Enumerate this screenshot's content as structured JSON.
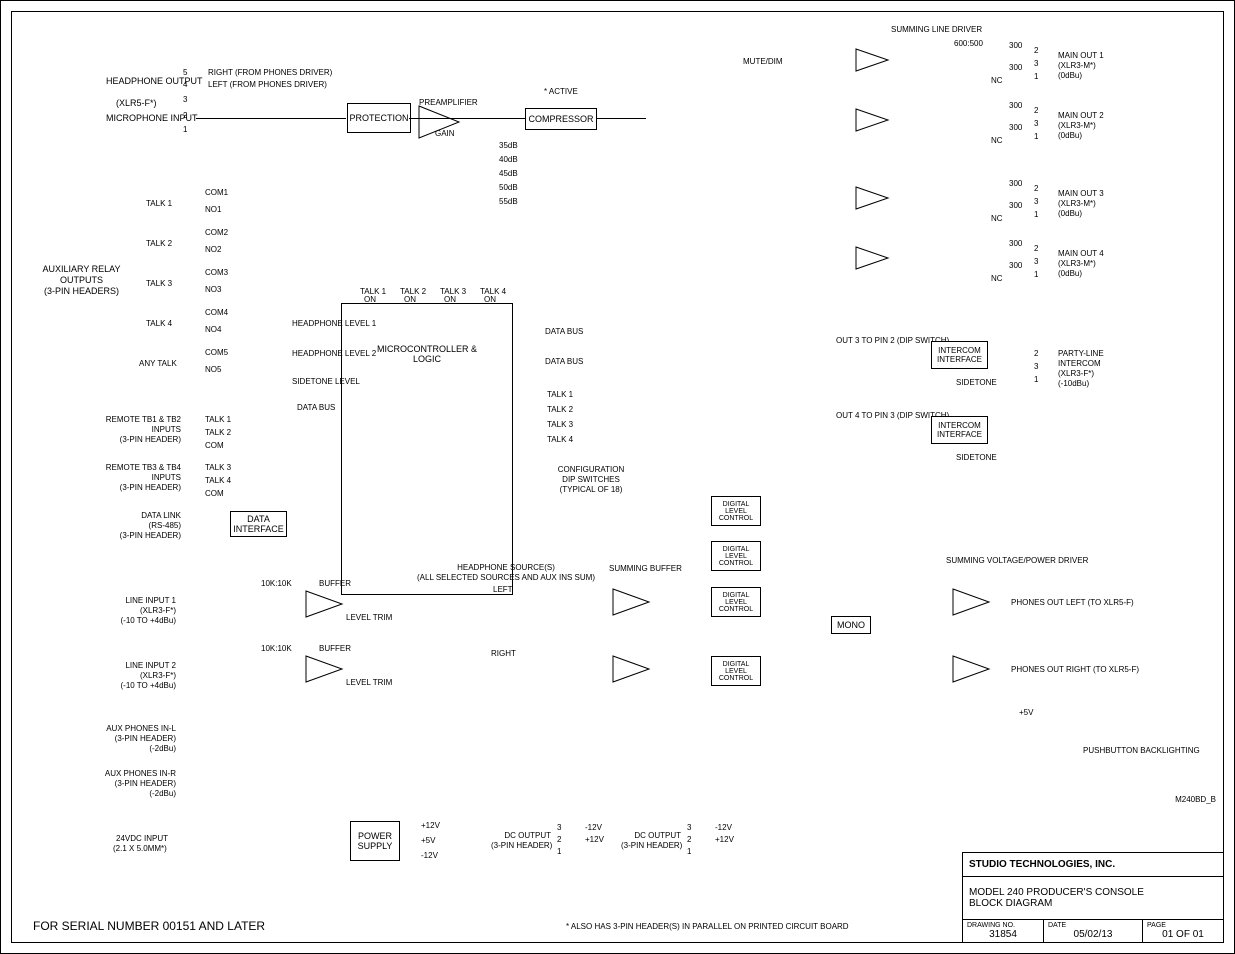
{
  "titleblock": {
    "company": "STUDIO TECHNOLOGIES, INC.",
    "title_l1": "MODEL 240 PRODUCER'S CONSOLE",
    "title_l2": "BLOCK DIAGRAM",
    "drawing_no_k": "DRAWING NO.",
    "drawing_no_v": "31854",
    "date_k": "DATE",
    "date_v": "05/02/13",
    "page_k": "PAGE",
    "page_v": "01  OF  01"
  },
  "footer": {
    "serial": "FOR SERIAL NUMBER 00151 AND LATER",
    "note": "* ALSO HAS 3-PIN HEADER(S) IN PARALLEL ON PRINTED CIRCUIT BOARD",
    "code": "M240BD_B"
  },
  "left": {
    "hp_out": "HEADPHONE OUTPUT",
    "hp_conn": "(XLR5-F*)",
    "mic_in": "MICROPHONE INPUT",
    "pin5": "5",
    "pin4": "4",
    "pin3": "3",
    "pin2": "2",
    "pin1": "1",
    "pin5_lbl": "RIGHT (FROM PHONES DRIVER)",
    "pin4_lbl": "LEFT (FROM PHONES DRIVER)",
    "aux_relay_t": "AUXILIARY RELAY",
    "aux_relay_b1": "OUTPUTS",
    "aux_relay_b2": "(3-PIN HEADERS)",
    "talk1": "TALK 1",
    "talk2": "TALK 2",
    "talk3": "TALK 3",
    "talk4": "TALK 4",
    "anytalk": "ANY TALK",
    "com1": "COM1",
    "no1": "NO1",
    "com2": "COM2",
    "no2": "NO2",
    "com3": "COM3",
    "no3": "NO3",
    "com4": "COM4",
    "no4": "NO4",
    "com5": "COM5",
    "no5": "NO5",
    "remote12_t": "REMOTE TB1 & TB2",
    "remote12_m": "INPUTS",
    "remote12_b": "(3-PIN HEADER)",
    "remote34_t": "REMOTE TB3 & TB4",
    "remote34_m": "INPUTS",
    "remote34_b": "(3-PIN HEADER)",
    "talk_s1": "TALK 1",
    "talk_s2": "TALK 2",
    "talk_s3": "TALK 3",
    "talk_s4": "TALK 4",
    "com": "COM",
    "datalink_t": "DATA LINK",
    "datalink_m": "(RS-485)",
    "datalink_b": "(3-PIN HEADER)",
    "line1_t": "LINE INPUT 1",
    "line1_m": "(XLR3-F*)",
    "line1_b": "(-10 TO +4dBu)",
    "line2_t": "LINE INPUT 2",
    "line2_m": "(XLR3-F*)",
    "line2_b": "(-10 TO +4dBu)",
    "aux_l_t": "AUX PHONES IN-L",
    "aux_l_m": "(3-PIN HEADER)",
    "aux_l_b": "(-2dBu)",
    "aux_r_t": "AUX PHONES IN-R",
    "aux_r_m": "(3-PIN HEADER)",
    "aux_r_b": "(-2dBu)",
    "dc_in_t": "24VDC INPUT",
    "dc_in_b": "(2.1 X 5.0MM*)"
  },
  "blocks": {
    "protection": "PROTECTION",
    "preamp": "PREAMPLIFIER",
    "gain": "GAIN",
    "g35": "35dB",
    "g40": "40dB",
    "g45": "45dB",
    "g50": "50dB",
    "g55": "55dB",
    "compressor": "COMPRESSOR",
    "active": "ACTIVE",
    "mcu": "MICROCONTROLLER & LOGIC",
    "mcu_talk1": "TALK 1",
    "mcu_talk2": "TALK 2",
    "mcu_talk3": "TALK 3",
    "mcu_talk4": "TALK 4",
    "mcu_on": "ON",
    "hplvl1": "HEADPHONE LEVEL 1",
    "hplvl2": "HEADPHONE LEVEL 2",
    "sidetone": "SIDETONE LEVEL",
    "databus": "DATA BUS",
    "talk_b1": "TALK 1",
    "talk_b2": "TALK 2",
    "talk_b3": "TALK 3",
    "talk_b4": "TALK 4",
    "cfg_t": "CONFIGURATION",
    "cfg_m": "DIP SWITCHES",
    "cfg_b": "(TYPICAL OF 18)",
    "datai": "DATA INTERFACE",
    "hpsrc_t": "HEADPHONE SOURCE(S)",
    "hpsrc_b": "(ALL SELECTED SOURCES AND AUX INS SUM)",
    "left_ch": "LEFT",
    "right_ch": "RIGHT",
    "buffer": "BUFFER",
    "leveltrim": "LEVEL TRIM",
    "tx": "10K:10K",
    "sumbuf": "SUMMING BUFFER",
    "dlc": "DIGITAL LEVEL CONTROL",
    "mono": "MONO",
    "sumline": "SUMMING LINE DRIVER",
    "tx600": "600:500",
    "r300": "300",
    "mutedim": "MUTE/DIM",
    "out3sw": "OUT 3 TO PIN 2 (DIP SWITCH)",
    "out4sw": "OUT 4 TO PIN 3 (DIP SWITCH)",
    "intercom": "INTERCOM INTERFACE",
    "sidetone_r": "SIDETONE",
    "sumvp": "SUMMING VOLTAGE/POWER DRIVER",
    "pbb": "PUSHBUTTON BACKLIGHTING",
    "p5v": "+5V",
    "ps": "POWER SUPPLY",
    "p12": "+12V",
    "p5": "+5V",
    "n12": "-12V",
    "dcout_t": "DC OUTPUT",
    "dcout_b": "(3-PIN HEADER)",
    "dc1": "+12V",
    "dc2": "-12V",
    "nc": "NC"
  },
  "right": {
    "mo1_t": "MAIN OUT 1",
    "mo_c": "(XLR3-M*)",
    "mo_l": "(0dBu)",
    "mo2_t": "MAIN OUT 2",
    "mo3_t": "MAIN OUT 3",
    "mo4_t": "MAIN OUT 4",
    "pl_t": "PARTY-LINE",
    "pl_m": "INTERCOM",
    "pl_c": "(XLR3-F*)",
    "pl_l": "(-10dBu)",
    "pol": "PHONES OUT LEFT (TO XLR5-F)",
    "por": "PHONES OUT RIGHT (TO XLR5-F)",
    "p2": "2",
    "p3": "3",
    "p1": "1"
  }
}
